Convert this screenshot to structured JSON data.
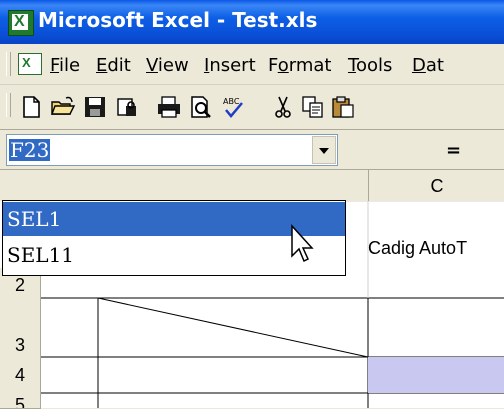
{
  "window": {
    "title": "Microsoft Excel - Test.xls"
  },
  "menu": [
    {
      "label": "File"
    },
    {
      "label": "Edit"
    },
    {
      "label": "View"
    },
    {
      "label": "Insert"
    },
    {
      "label": "Format"
    },
    {
      "label": "Tools"
    },
    {
      "label": "Dat"
    }
  ],
  "toolbar": {
    "icons": [
      "new-icon",
      "open-icon",
      "save-icon",
      "permission-icon",
      "print-icon",
      "print-preview-icon",
      "spelling-icon",
      "cut-icon",
      "copy-icon",
      "paste-icon"
    ]
  },
  "formula_bar": {
    "name_box_value": "F23",
    "equals": "="
  },
  "name_dropdown": {
    "options": [
      "SEL1",
      "SEL11"
    ],
    "selected_index": 0
  },
  "sheet": {
    "column_headers": [
      "C"
    ],
    "row_headers": [
      "2",
      "3",
      "4",
      "5"
    ],
    "cell_c1_text": "Cadig AutoT"
  },
  "colors": {
    "selection": "#316ac5",
    "highlight_cell": "#c8c8f0",
    "title_bar": "#0a58e8"
  }
}
